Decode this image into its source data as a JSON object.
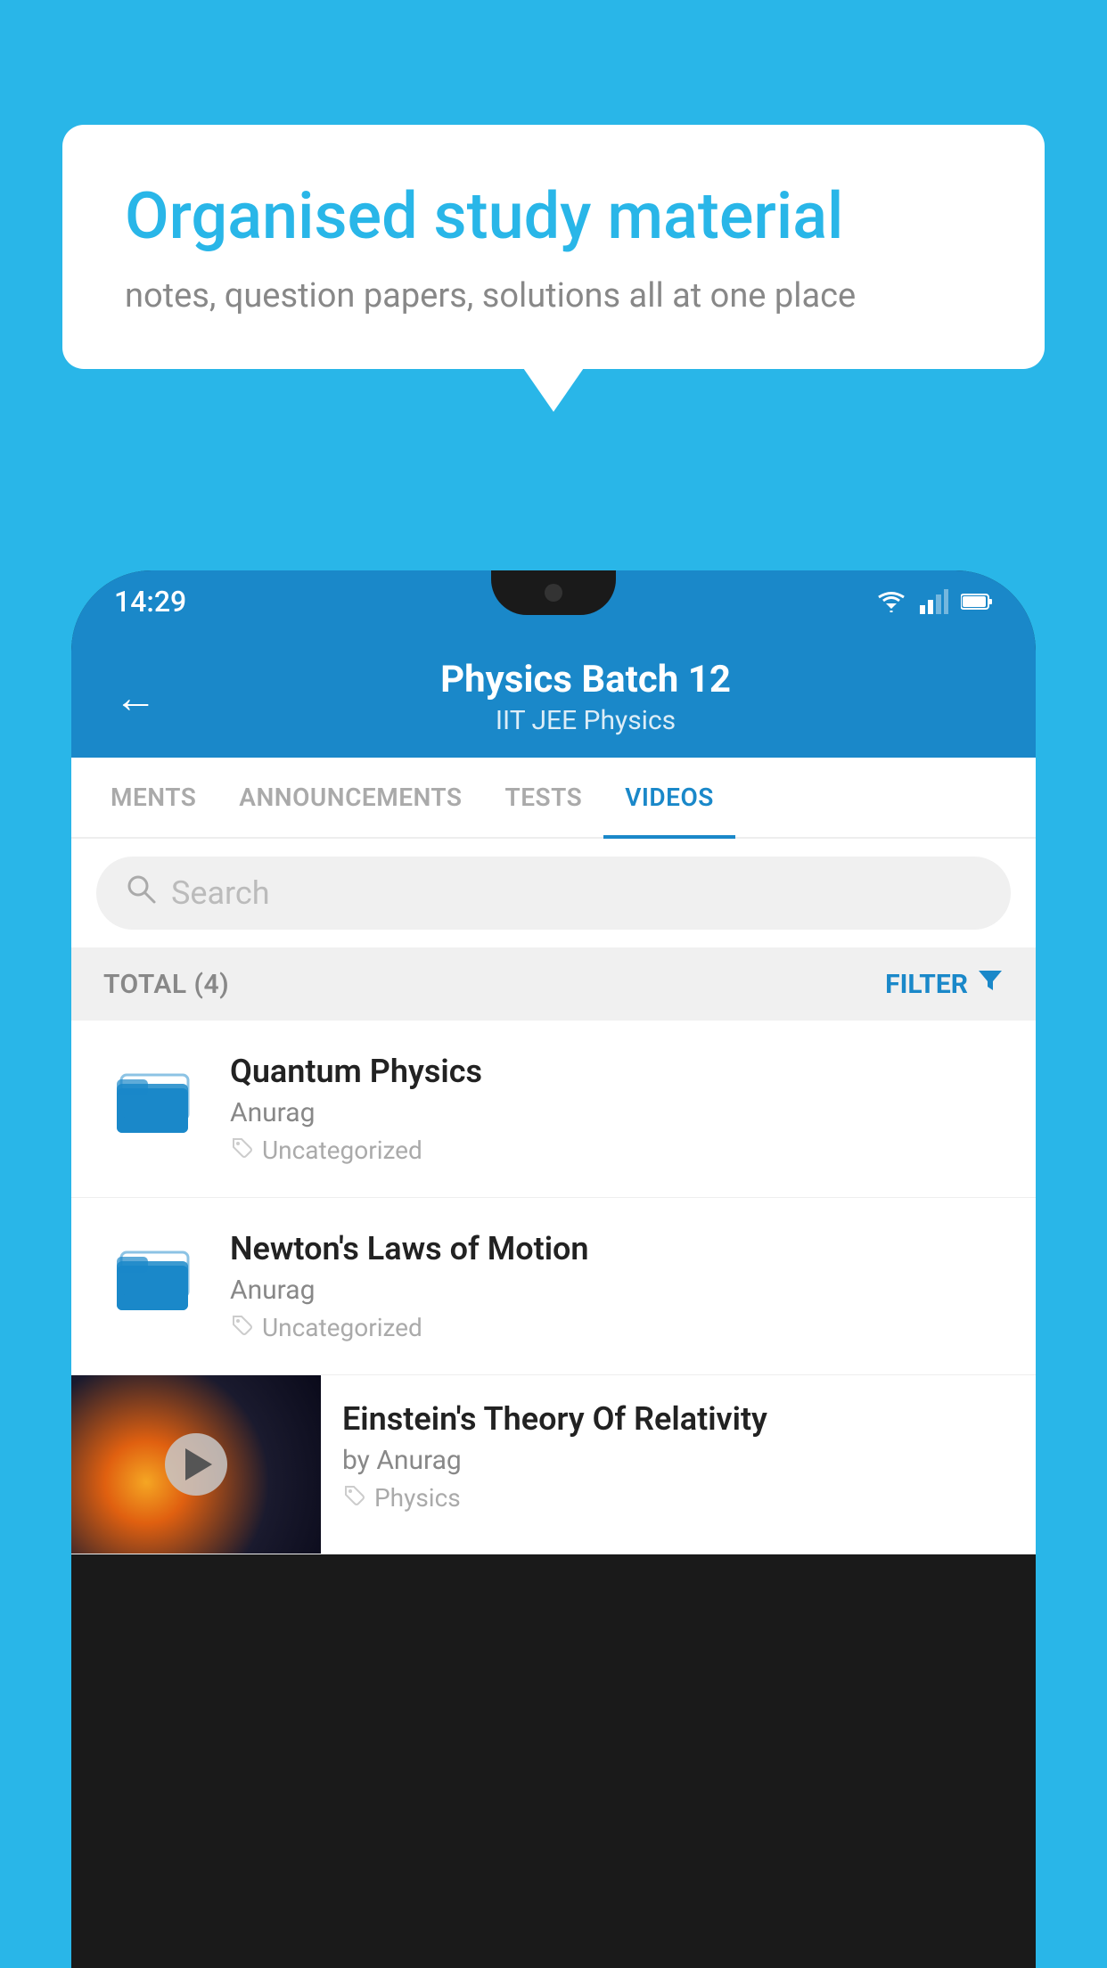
{
  "background": {
    "color": "#29b6e8"
  },
  "speech_bubble": {
    "title": "Organised study material",
    "subtitle": "notes, question papers, solutions all at one place"
  },
  "status_bar": {
    "time": "14:29"
  },
  "app_header": {
    "title": "Physics Batch 12",
    "subtitle": "IIT JEE   Physics",
    "back_label": "←"
  },
  "tabs": [
    {
      "label": "MENTS",
      "active": false
    },
    {
      "label": "ANNOUNCEMENTS",
      "active": false
    },
    {
      "label": "TESTS",
      "active": false
    },
    {
      "label": "VIDEOS",
      "active": true
    }
  ],
  "search": {
    "placeholder": "Search"
  },
  "filter_bar": {
    "total_label": "TOTAL (4)",
    "filter_label": "FILTER"
  },
  "video_items": [
    {
      "title": "Quantum Physics",
      "author": "Anurag",
      "tag": "Uncategorized",
      "has_thumbnail": false
    },
    {
      "title": "Newton's Laws of Motion",
      "author": "Anurag",
      "tag": "Uncategorized",
      "has_thumbnail": false
    },
    {
      "title": "Einstein's Theory Of Relativity",
      "author": "by Anurag",
      "tag": "Physics",
      "has_thumbnail": true
    }
  ]
}
